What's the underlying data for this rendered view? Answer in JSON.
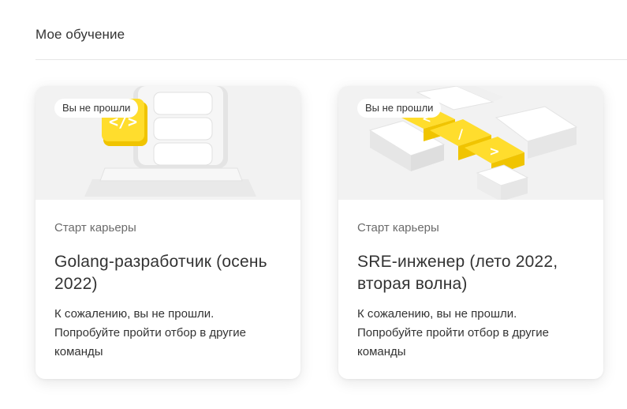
{
  "section": {
    "title": "Мое обучение"
  },
  "cards": [
    {
      "image_icon": "code-blocks-illustration",
      "badge": "Вы не прошли",
      "category": "Старт карьеры",
      "title": "Golang-разработчик (осень 2022)",
      "description_line1": "К сожалению, вы не прошли.",
      "description_line2": "Попробуйте пройти отбор в другие команды"
    },
    {
      "image_icon": "keyboard-keys-illustration",
      "badge": "Вы не прошли",
      "category": "Старт карьеры",
      "title": "SRE-инженер (лето 2022, вторая волна)",
      "description_line1": "К сожалению, вы не прошли.",
      "description_line2": "Попробуйте пройти отбор в другие команды"
    }
  ],
  "colors": {
    "accent_yellow": "#ffdd2d",
    "image_background": "#f2f2f2",
    "text_primary": "#333333",
    "text_secondary": "#6b6b6b"
  }
}
